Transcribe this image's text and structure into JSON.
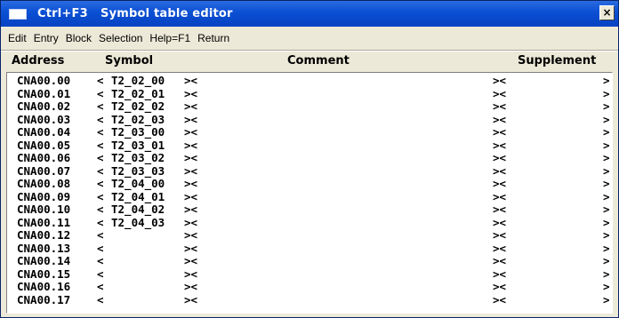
{
  "window": {
    "title": "Ctrl+F3   Symbol table editor",
    "close_label": "×"
  },
  "menu": [
    "Edit",
    "Entry",
    "Block",
    "Selection",
    "Help=F1",
    "Return"
  ],
  "columns": {
    "address": "Address",
    "symbol": "Symbol",
    "comment": "Comment",
    "supplement": "Supplement"
  },
  "delimiters": {
    "symbol_open": "<",
    "symbol_close_comment_open": "><",
    "comment_close_supplement_open": "><",
    "supplement_close": ">"
  },
  "rows": [
    {
      "address": "CNA00.00",
      "symbol": "T2_02_00"
    },
    {
      "address": "CNA00.01",
      "symbol": "T2_02_01"
    },
    {
      "address": "CNA00.02",
      "symbol": "T2_02_02"
    },
    {
      "address": "CNA00.03",
      "symbol": "T2_02_03"
    },
    {
      "address": "CNA00.04",
      "symbol": "T2_03_00"
    },
    {
      "address": "CNA00.05",
      "symbol": "T2_03_01"
    },
    {
      "address": "CNA00.06",
      "symbol": "T2_03_02"
    },
    {
      "address": "CNA00.07",
      "symbol": "T2_03_03"
    },
    {
      "address": "CNA00.08",
      "symbol": "T2_04_00"
    },
    {
      "address": "CNA00.09",
      "symbol": "T2_04_01"
    },
    {
      "address": "CNA00.10",
      "symbol": "T2_04_02"
    },
    {
      "address": "CNA00.11",
      "symbol": "T2_04_03"
    },
    {
      "address": "CNA00.12",
      "symbol": ""
    },
    {
      "address": "CNA00.13",
      "symbol": ""
    },
    {
      "address": "CNA00.14",
      "symbol": ""
    },
    {
      "address": "CNA00.15",
      "symbol": ""
    },
    {
      "address": "CNA00.16",
      "symbol": ""
    },
    {
      "address": "CNA00.17",
      "symbol": ""
    }
  ]
}
